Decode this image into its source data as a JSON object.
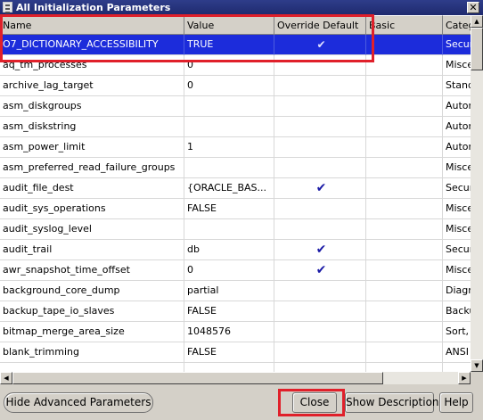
{
  "window": {
    "title": "All Initialization Parameters",
    "close_glyph": "✕"
  },
  "columns": [
    "Name",
    "Value",
    "Override Default",
    "Basic",
    "Category"
  ],
  "rows": [
    {
      "name": "O7_DICTIONARY_ACCESSIBILITY",
      "value": "TRUE",
      "override": true,
      "category": "Security",
      "selected": true
    },
    {
      "name": "aq_tm_processes",
      "value": "0",
      "override": false,
      "category": "Miscellaneous"
    },
    {
      "name": "archive_lag_target",
      "value": "0",
      "override": false,
      "category": "Standby"
    },
    {
      "name": "asm_diskgroups",
      "value": "",
      "override": false,
      "category": "Automatic"
    },
    {
      "name": "asm_diskstring",
      "value": "",
      "override": false,
      "category": "Automatic"
    },
    {
      "name": "asm_power_limit",
      "value": "1",
      "override": false,
      "category": "Automatic"
    },
    {
      "name": "asm_preferred_read_failure_groups",
      "value": "",
      "override": false,
      "category": "Miscellaneous"
    },
    {
      "name": "audit_file_dest",
      "value": "{ORACLE_BAS...",
      "override": true,
      "category": "Security"
    },
    {
      "name": "audit_sys_operations",
      "value": "FALSE",
      "override": false,
      "category": "Miscellaneous"
    },
    {
      "name": "audit_syslog_level",
      "value": "",
      "override": false,
      "category": "Miscellaneous"
    },
    {
      "name": "audit_trail",
      "value": "db",
      "override": true,
      "category": "Security"
    },
    {
      "name": "awr_snapshot_time_offset",
      "value": "0",
      "override": true,
      "category": "Miscellaneous"
    },
    {
      "name": "background_core_dump",
      "value": "partial",
      "override": false,
      "category": "Diagnostics"
    },
    {
      "name": "backup_tape_io_slaves",
      "value": "FALSE",
      "override": false,
      "category": "Backup"
    },
    {
      "name": "bitmap_merge_area_size",
      "value": "1048576",
      "override": false,
      "category": "Sort,"
    },
    {
      "name": "blank_trimming",
      "value": "FALSE",
      "override": false,
      "category": "ANSI"
    },
    {
      "name": "",
      "value": "",
      "override": false,
      "category": ""
    }
  ],
  "check_glyph": "✔",
  "buttons": {
    "hide_advanced": "Hide Advanced Parameters",
    "close": "Close",
    "show_description": "Show Description",
    "help": "Help"
  },
  "colors": {
    "selection": "#1c2cdb",
    "highlight": "#e0202a",
    "check": "#1a1aa6"
  }
}
